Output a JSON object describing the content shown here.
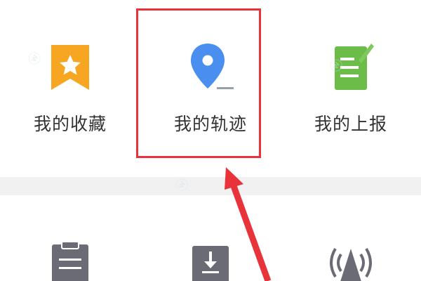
{
  "menu": {
    "row1": [
      {
        "label": "我的收藏",
        "icon": "favorites-icon"
      },
      {
        "label": "我的轨迹",
        "icon": "location-pin-icon"
      },
      {
        "label": "我的上报",
        "icon": "report-note-icon"
      }
    ],
    "row2": [
      {
        "icon": "clipboard-icon"
      },
      {
        "icon": "download-icon"
      },
      {
        "icon": "signal-broadcast-icon"
      }
    ]
  },
  "colors": {
    "favorites": "#f6a621",
    "location": "#4a8ef0",
    "report": "#6cbc4a",
    "row2_icons": "#6b6b75",
    "highlight": "#e8333a"
  }
}
